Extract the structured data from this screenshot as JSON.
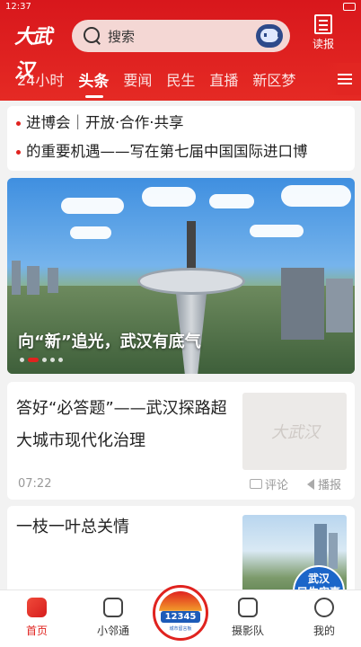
{
  "status_bar": {
    "time": "12:37"
  },
  "header": {
    "logo_text": "大武汉",
    "search_placeholder": "搜索",
    "read_button_label": "读报",
    "tabs": [
      {
        "label": "24小时"
      },
      {
        "label": "头条"
      },
      {
        "label": "要闻"
      },
      {
        "label": "民生"
      },
      {
        "label": "直播"
      },
      {
        "label": "新区梦"
      }
    ],
    "active_tab": "头条"
  },
  "ticker": {
    "items": [
      {
        "text": "进博会｜开放·合作·共享"
      },
      {
        "text": "的重要机遇——写在第七届中国国际进口博"
      }
    ]
  },
  "banner": {
    "title": "向“新”追光，武汉有底气",
    "slide_count": 5,
    "active_slide": 1
  },
  "feed": {
    "articles": [
      {
        "title": "答好“必答题”——武汉探路超大城市现代化治理",
        "time": "07:22",
        "comment_label": "评论",
        "broadcast_label": "播报",
        "thumb_text": "大武汉"
      },
      {
        "title": "一枝一叶总关情",
        "thumb_badge_line1": "武汉",
        "thumb_badge_line2": "民生实事"
      }
    ]
  },
  "bottom_nav": {
    "items": [
      {
        "label": "首页"
      },
      {
        "label": "小邻通"
      },
      {
        "label": "摄影队"
      },
      {
        "label": "我的"
      }
    ],
    "center_number": "12345",
    "center_sub": "城市留言板"
  },
  "colors": {
    "brand_red": "#e0231f",
    "header_red": "#d8171c"
  }
}
